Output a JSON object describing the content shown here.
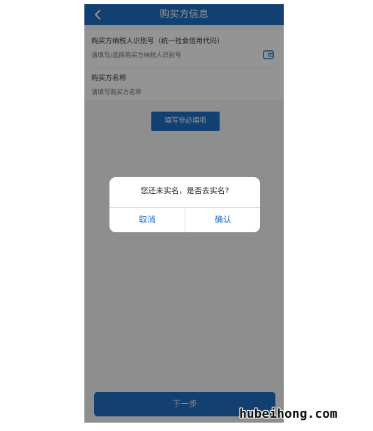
{
  "header": {
    "title": "购买方信息",
    "back_icon": "chevron-left-icon"
  },
  "form": {
    "taxpayer_id": {
      "label": "购买方纳税人识别号（统一社会信用代码）",
      "placeholder": "请填写/选择购买方纳税人识别号"
    },
    "buyer_name": {
      "label": "购买方名称",
      "placeholder": "请填写购买方名称"
    },
    "wallet_icon": "wallet-icon"
  },
  "optional_button": {
    "label": "填写非必填项"
  },
  "next_button": {
    "label": "下一步"
  },
  "dialog": {
    "message": "您还未实名，是否去实名?",
    "cancel_label": "取消",
    "confirm_label": "确认"
  },
  "watermark": {
    "text": "hubeihong.com"
  },
  "colors": {
    "brand": "#1e6fc3",
    "overlay": "rgba(0,0,0,0.42)"
  }
}
